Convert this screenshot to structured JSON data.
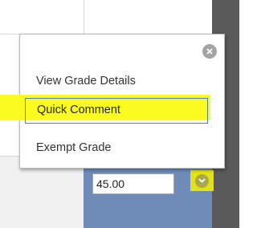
{
  "grid": {
    "grade_value": "45.00"
  },
  "popup": {
    "items": [
      {
        "label": "View Grade Details"
      },
      {
        "label": "Quick Comment"
      },
      {
        "label": "Exempt Grade"
      }
    ]
  },
  "icons": {
    "close": "close-icon",
    "dropdown": "chevron-down-icon"
  },
  "colors": {
    "highlight": "#fbfb22",
    "selected_cell": "#6f8cb9",
    "focus_border": "#4c7ec4",
    "right_bar": "#5a5a5a"
  }
}
